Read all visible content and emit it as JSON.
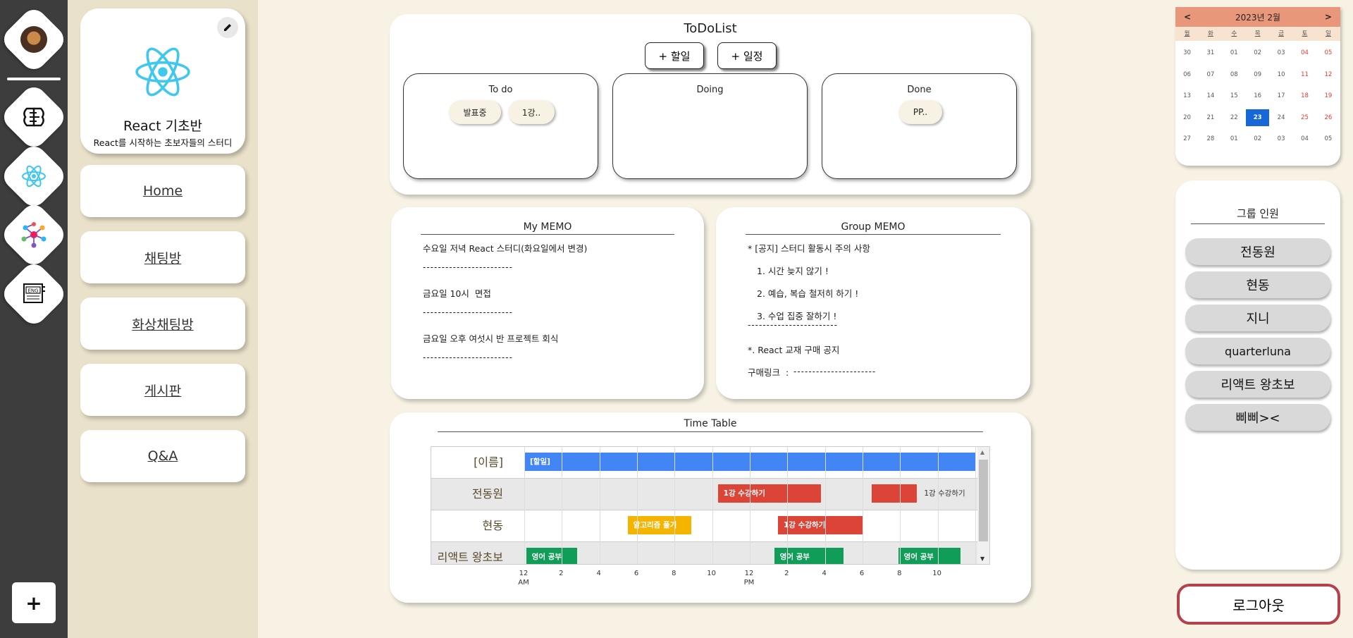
{
  "sidebar": {
    "icons": [
      "profile-avatar",
      "brain-icon",
      "react-logo-icon",
      "network-icon",
      "english-book-icon"
    ],
    "add_label": "+"
  },
  "group": {
    "title": "React 기초반",
    "subtitle": "React를 시작하는 초보자들의 스터디"
  },
  "nav": {
    "items": [
      "Home",
      "채팅방",
      "화상채팅방",
      "게시판",
      "Q&A"
    ]
  },
  "todo": {
    "title": "ToDoList",
    "add_task": "+ 할일",
    "add_schedule": "+ 일정",
    "columns": [
      {
        "title": "To do",
        "chips": [
          "발표중",
          "1강.."
        ]
      },
      {
        "title": "Doing",
        "chips": []
      },
      {
        "title": "Done",
        "chips": [
          "PP.."
        ]
      }
    ]
  },
  "my_memo": {
    "title": "My MEMO",
    "lines": [
      "수요일 저녁 React 스터디(화요일에서 변경)",
      "금요일 10시  면접",
      "금요일 오후 여섯시 반 프로젝트 회식"
    ],
    "divider": "------------------------"
  },
  "group_memo": {
    "title": "Group MEMO",
    "lines": [
      "* [공지] 스터디 활동시 주의 사항",
      "1. 시간 늦지 않기 !",
      "2. 예습, 복습 철저히 하기 !",
      "3. 수업 집중 잘하기 !",
      "*. React 교재 구매 공지",
      "구매링크  :"
    ],
    "divider": "------------------------",
    "link_dash": "----------------------"
  },
  "timetable": {
    "title": "Time Table",
    "rows": [
      {
        "label": "[이름]",
        "bars": [
          {
            "text": "[할일]",
            "start": 0,
            "end": 24,
            "color": "#4285f4"
          }
        ],
        "extra": ""
      },
      {
        "label": "전동원",
        "bars": [
          {
            "text": "1강 수강하기",
            "start": 10.3,
            "end": 15.8,
            "color": "#db4437"
          },
          {
            "text": "",
            "start": 18.5,
            "end": 20.9,
            "color": "#db4437"
          }
        ],
        "extra": "1강 수강하기"
      },
      {
        "label": "현동",
        "bars": [
          {
            "text": "알고리즘 풀기",
            "start": 5.5,
            "end": 8.9,
            "color": "#f4b400"
          },
          {
            "text": "1강 수강하기",
            "start": 13.5,
            "end": 18,
            "color": "#db4437"
          }
        ],
        "extra": ""
      },
      {
        "label": "리액트 왕초보",
        "bars": [
          {
            "text": "영어 공부",
            "start": 0.1,
            "end": 2.8,
            "color": "#0f9d58"
          },
          {
            "text": "영어 공부",
            "start": 13.3,
            "end": 17,
            "color": "#0f9d58"
          },
          {
            "text": "영어 공부",
            "start": 19.9,
            "end": 23.2,
            "color": "#0f9d58"
          }
        ],
        "extra": ""
      }
    ],
    "ticks": [
      "12\nAM",
      "2",
      "4",
      "6",
      "8",
      "10",
      "12\nPM",
      "2",
      "4",
      "6",
      "8",
      "10"
    ]
  },
  "calendar": {
    "title": "2023년 2월",
    "prev": "<",
    "next": ">",
    "dow": [
      "월",
      "화",
      "수",
      "목",
      "금",
      "토",
      "일"
    ],
    "weeks": [
      [
        "30",
        "31",
        "01",
        "02",
        "03",
        "04",
        "05"
      ],
      [
        "06",
        "07",
        "08",
        "09",
        "10",
        "11",
        "12"
      ],
      [
        "13",
        "14",
        "15",
        "16",
        "17",
        "18",
        "19"
      ],
      [
        "20",
        "21",
        "22",
        "23",
        "24",
        "25",
        "26"
      ],
      [
        "27",
        "28",
        "01",
        "02",
        "03",
        "04",
        "05"
      ]
    ],
    "selected": "23",
    "weekend_color": "#e53935"
  },
  "members": {
    "title": "그룹 인원",
    "list": [
      "전동원",
      "현동",
      "지니",
      "quarterluna",
      "리액트 왕초보",
      "삐삐><"
    ]
  },
  "logout_label": "로그아웃"
}
